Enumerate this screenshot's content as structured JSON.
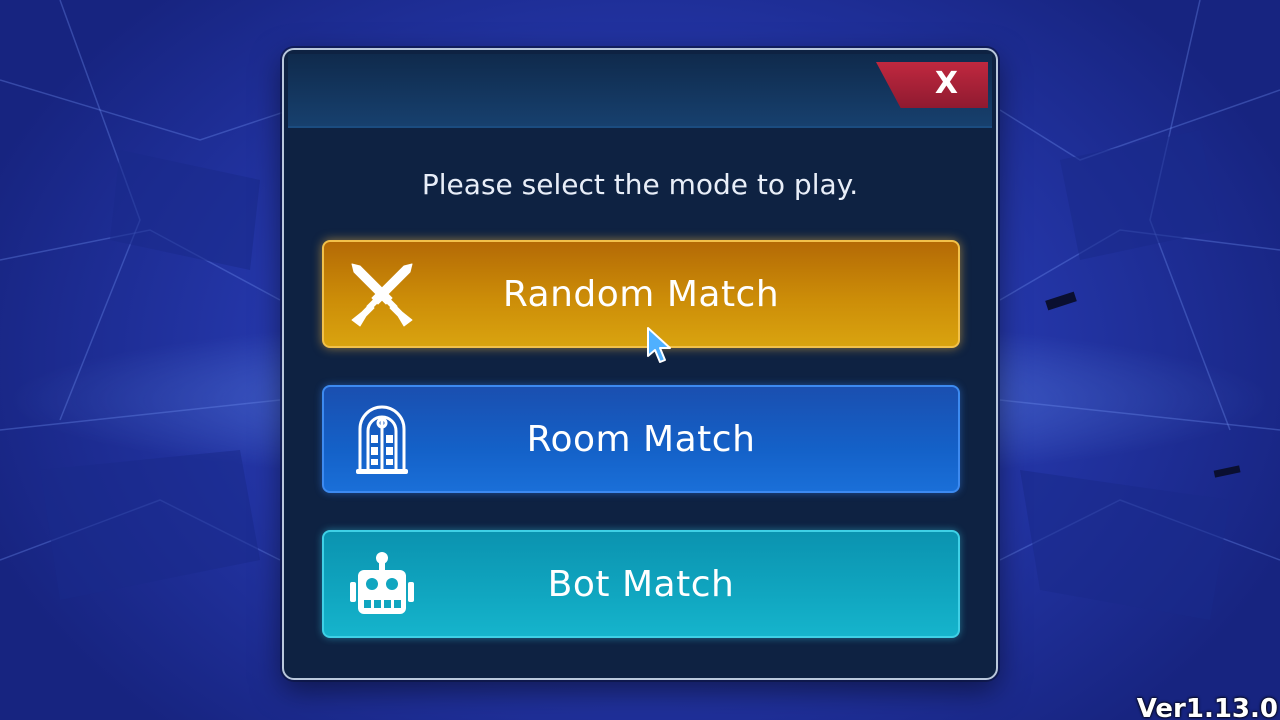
{
  "dialog": {
    "prompt": "Please select the mode to play.",
    "close_label": "X",
    "modes": [
      {
        "label": "Random Match",
        "icon": "crossed-swords-icon",
        "color": "#cc8d08"
      },
      {
        "label": "Room Match",
        "icon": "door-icon",
        "color": "#1461c8"
      },
      {
        "label": "Bot Match",
        "icon": "robot-icon",
        "color": "#10a6c0"
      }
    ]
  },
  "version": "Ver1.13.0",
  "colors": {
    "accent_close": "#c0283f",
    "dialog_bg": "#0e2242"
  }
}
